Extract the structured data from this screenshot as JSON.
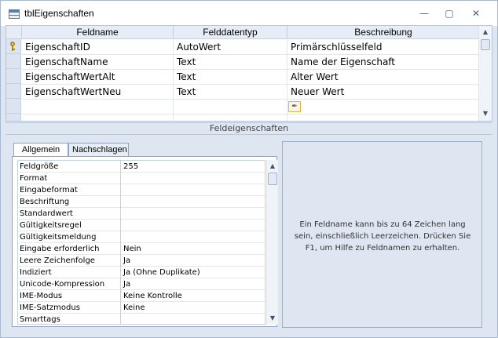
{
  "window": {
    "title": "tblEigenschaften",
    "minimize": "—",
    "restore": "▢",
    "close": "✕"
  },
  "grid": {
    "columns": [
      "Feldname",
      "Felddatentyp",
      "Beschreibung"
    ],
    "rows": [
      {
        "feldname": "EigenschaftID",
        "typ": "AutoWert",
        "beschreibung": "Primärschlüsselfeld",
        "primary_key": true
      },
      {
        "feldname": "EigenschaftName",
        "typ": "Text",
        "beschreibung": "Name der Eigenschaft"
      },
      {
        "feldname": "EigenschaftWertAlt",
        "typ": "Text",
        "beschreibung": "Alter Wert"
      },
      {
        "feldname": "EigenschaftWertNeu",
        "typ": "Text",
        "beschreibung": "Neuer Wert"
      },
      {
        "feldname": "",
        "typ": "",
        "beschreibung": ""
      },
      {
        "feldname": "",
        "typ": "",
        "beschreibung": ""
      }
    ],
    "scroll_up": "▲",
    "scroll_down": "▼",
    "builder_icon": "wand-builder-icon"
  },
  "section_label": "Feldeigenschaften",
  "tabs": [
    {
      "label": "Allgemein",
      "active": true
    },
    {
      "label": "Nachschlagen",
      "active": false
    }
  ],
  "properties": [
    {
      "name": "Feldgröße",
      "value": "255"
    },
    {
      "name": "Format",
      "value": ""
    },
    {
      "name": "Eingabeformat",
      "value": ""
    },
    {
      "name": "Beschriftung",
      "value": ""
    },
    {
      "name": "Standardwert",
      "value": ""
    },
    {
      "name": "Gültigkeitsregel",
      "value": ""
    },
    {
      "name": "Gültigkeitsmeldung",
      "value": ""
    },
    {
      "name": "Eingabe erforderlich",
      "value": "Nein"
    },
    {
      "name": "Leere Zeichenfolge",
      "value": "Ja"
    },
    {
      "name": "Indiziert",
      "value": "Ja (Ohne Duplikate)"
    },
    {
      "name": "Unicode-Kompression",
      "value": "Ja"
    },
    {
      "name": "IME-Modus",
      "value": "Keine Kontrolle"
    },
    {
      "name": "IME-Satzmodus",
      "value": "Keine"
    },
    {
      "name": "Smarttags",
      "value": ""
    }
  ],
  "help_text": "Ein Feldname kann bis zu 64 Zeichen lang sein, einschließlich Leerzeichen. Drücken Sie F1, um Hilfe zu Feldnamen zu erhalten."
}
